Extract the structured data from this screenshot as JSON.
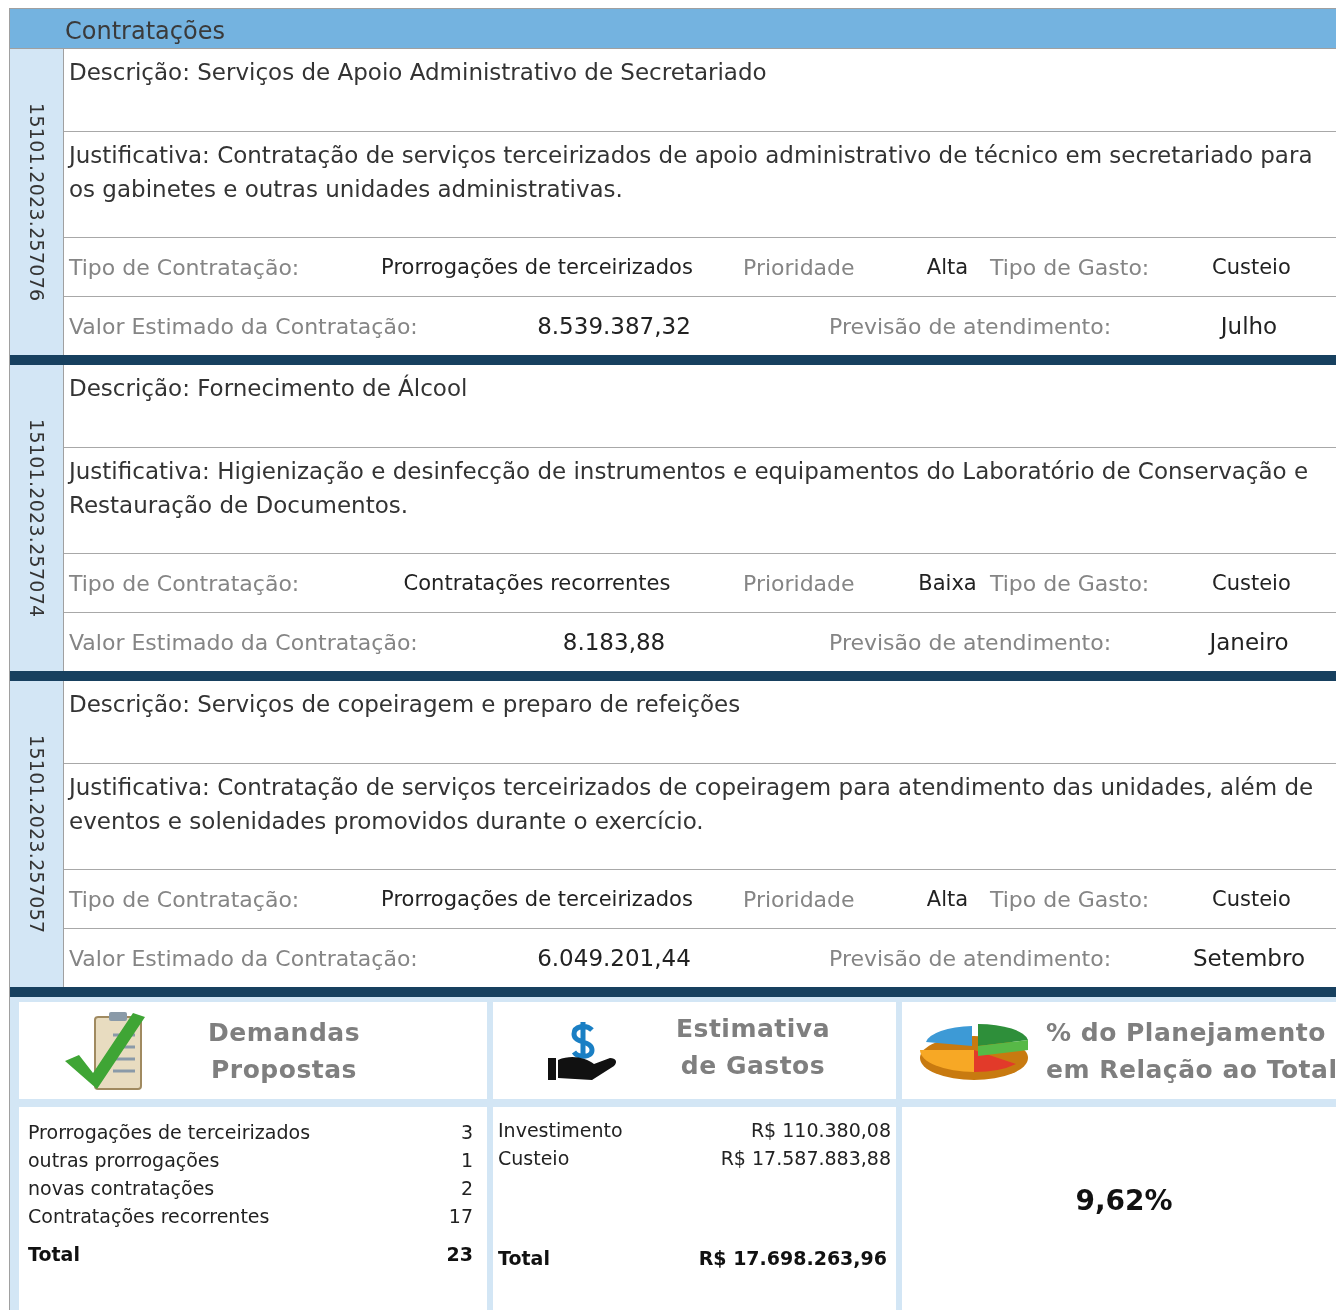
{
  "title": "Contratações",
  "records": [
    {
      "code": "15101.2023.257076",
      "description": "Descrição: Serviços de Apoio Administrativo de Secretariado",
      "justification": "Justificativa: Contratação de serviços terceirizados de apoio administrativo de técnico em secretariado para os gabinetes e outras unidades administrativas.",
      "type_row": [
        {
          "label": "Tipo de Contratação:",
          "value": "Prorrogações de terceirizados"
        },
        {
          "label": "Prioridade",
          "value": "Alta"
        },
        {
          "label": "Tipo de Gasto:",
          "value": "Custeio"
        }
      ],
      "value_row": [
        {
          "label": "Valor Estimado da Contratação:",
          "value": "8.539.387,32"
        },
        {
          "label": "Previsão de atendimento:",
          "value": "Julho"
        }
      ]
    },
    {
      "code": "15101.2023.257074",
      "description": "Descrição: Fornecimento de Álcool",
      "justification": "Justificativa: Higienização e desinfecção de instrumentos e equipamentos do Laboratório de Conservação e Restauração de Documentos.",
      "type_row": [
        {
          "label": "Tipo de Contratação:",
          "value": "Contratações recorrentes"
        },
        {
          "label": "Prioridade",
          "value": "Baixa"
        },
        {
          "label": "Tipo de Gasto:",
          "value": "Custeio"
        }
      ],
      "value_row": [
        {
          "label": "Valor Estimado da Contratação:",
          "value": "8.183,88"
        },
        {
          "label": "Previsão de atendimento:",
          "value": "Janeiro"
        }
      ]
    },
    {
      "code": "15101.2023.257057",
      "description": "Descrição: Serviços de copeiragem e preparo de refeições",
      "justification": "Justificativa: Contratação de serviços terceirizados de copeiragem para atendimento das unidades, além de eventos e solenidades promovidos durante o exercício.",
      "type_row": [
        {
          "label": "Tipo de Contratação:",
          "value": "Prorrogações de terceirizados"
        },
        {
          "label": "Prioridade",
          "value": "Alta"
        },
        {
          "label": "Tipo de Gasto:",
          "value": "Custeio"
        }
      ],
      "value_row": [
        {
          "label": "Valor Estimado da Contratação:",
          "value": "6.049.201,44"
        },
        {
          "label": "Previsão de atendimento:",
          "value": "Setembro"
        }
      ]
    }
  ],
  "summary": [
    {
      "kind": "demands",
      "title": "Demandas Propostas",
      "rows": [
        {
          "label": "Prorrogações de terceirizados",
          "value": "3"
        },
        {
          "label": "outras prorrogações",
          "value": "1"
        },
        {
          "label": "novas contratações",
          "value": "2"
        },
        {
          "label": "Contratações recorrentes",
          "value": "17"
        }
      ],
      "total": {
        "label": "Total",
        "value": "23"
      }
    },
    {
      "kind": "costs",
      "title": "Estimativa de Gastos",
      "rows": [
        {
          "label": "Investimento",
          "value": "R$ 110.380,08"
        },
        {
          "label": "Custeio",
          "value": "R$ 17.587.883,88"
        }
      ],
      "total": {
        "label": "Total",
        "value": "R$ 17.698.263,96"
      }
    },
    {
      "kind": "percent",
      "title": "% do Planejamento em Relação ao Total",
      "value": "9,62%"
    }
  ]
}
